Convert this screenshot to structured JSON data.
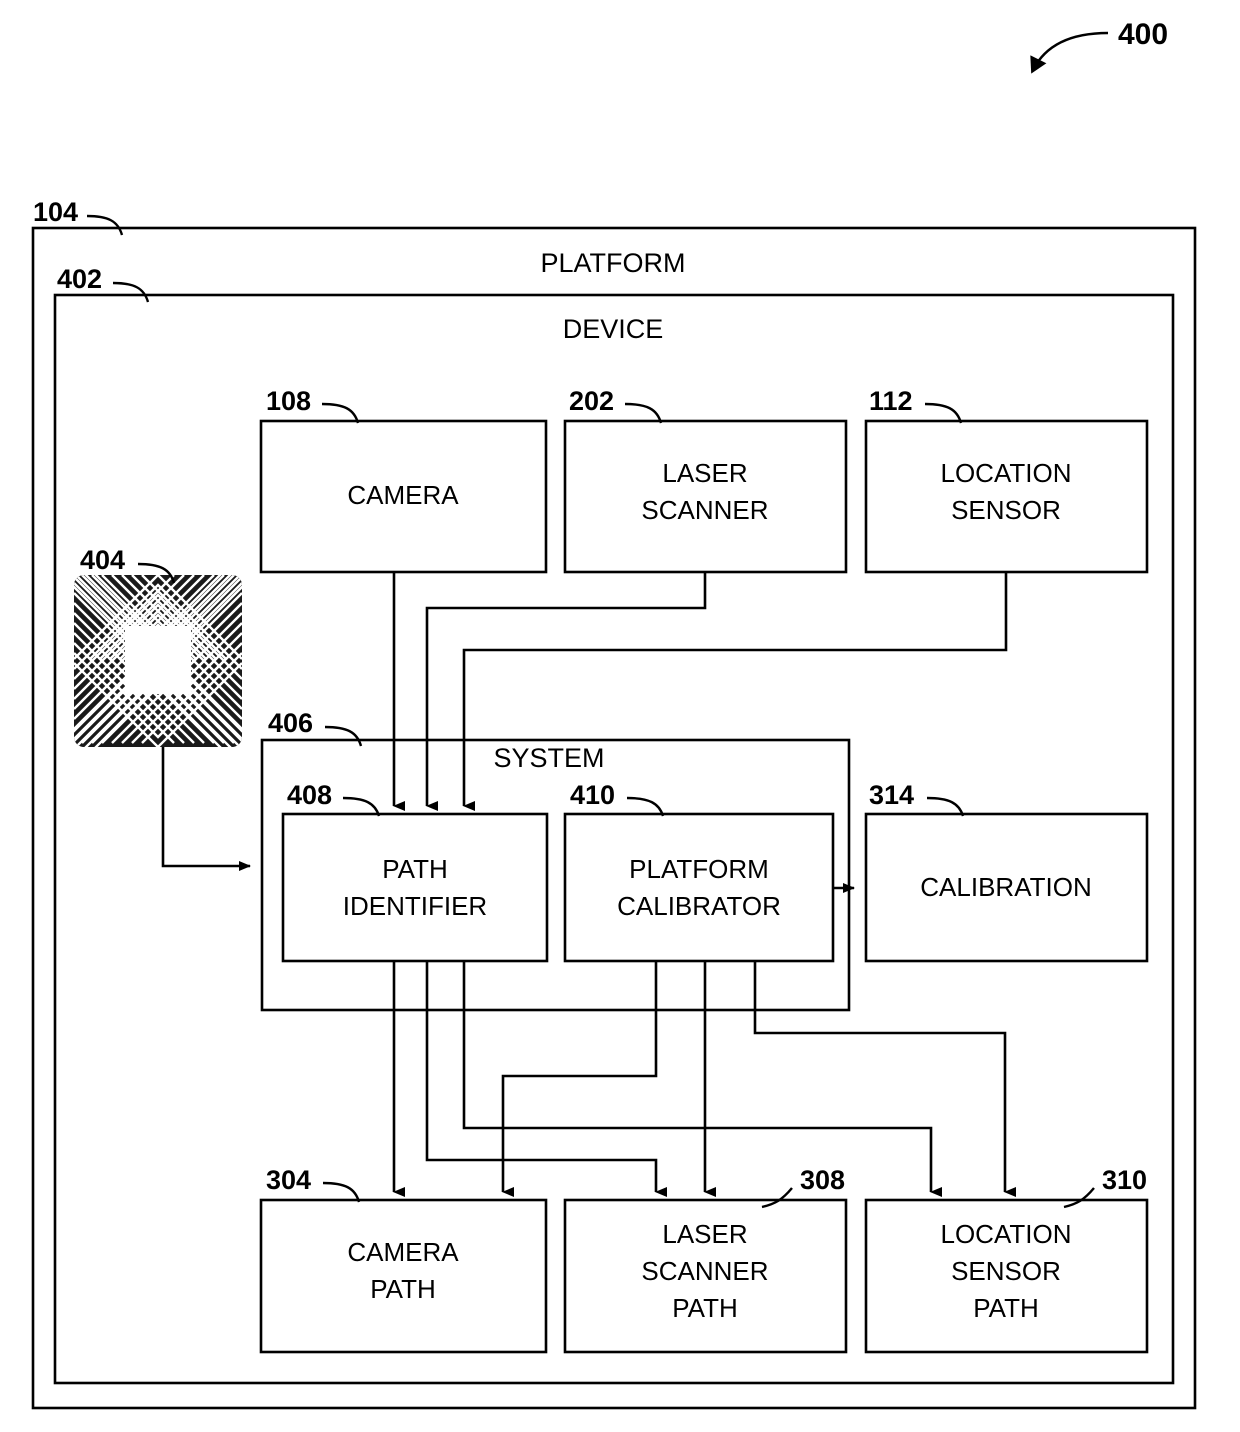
{
  "figure": {
    "number": "400",
    "pointer_icon": "curved-arrow-icon"
  },
  "containers": [
    {
      "ref": "104",
      "label": "PLATFORM"
    },
    {
      "ref": "402",
      "label": "DEVICE"
    },
    {
      "ref": "406",
      "label": "SYSTEM"
    }
  ],
  "sensors": [
    {
      "ref": "108",
      "line1": "CAMERA",
      "line2": ""
    },
    {
      "ref": "202",
      "line1": "LASER",
      "line2": "SCANNER"
    },
    {
      "ref": "112",
      "line1": "LOCATION",
      "line2": "SENSOR"
    }
  ],
  "marker": {
    "ref": "404",
    "icon": "fiducial-marker-icon"
  },
  "system_blocks": [
    {
      "ref": "408",
      "line1": "PATH",
      "line2": "IDENTIFIER"
    },
    {
      "ref": "410",
      "line1": "PLATFORM",
      "line2": "CALIBRATOR"
    }
  ],
  "output_block": {
    "ref": "314",
    "line1": "CALIBRATION",
    "line2": ""
  },
  "paths": [
    {
      "ref": "304",
      "line1": "CAMERA",
      "line2": "PATH",
      "line3": ""
    },
    {
      "ref": "308",
      "line1": "LASER",
      "line2": "SCANNER",
      "line3": "PATH"
    },
    {
      "ref": "310",
      "line1": "LOCATION",
      "line2": "SENSOR",
      "line3": "PATH"
    }
  ],
  "colors": {
    "stroke": "#000000",
    "background": "#ffffff"
  }
}
